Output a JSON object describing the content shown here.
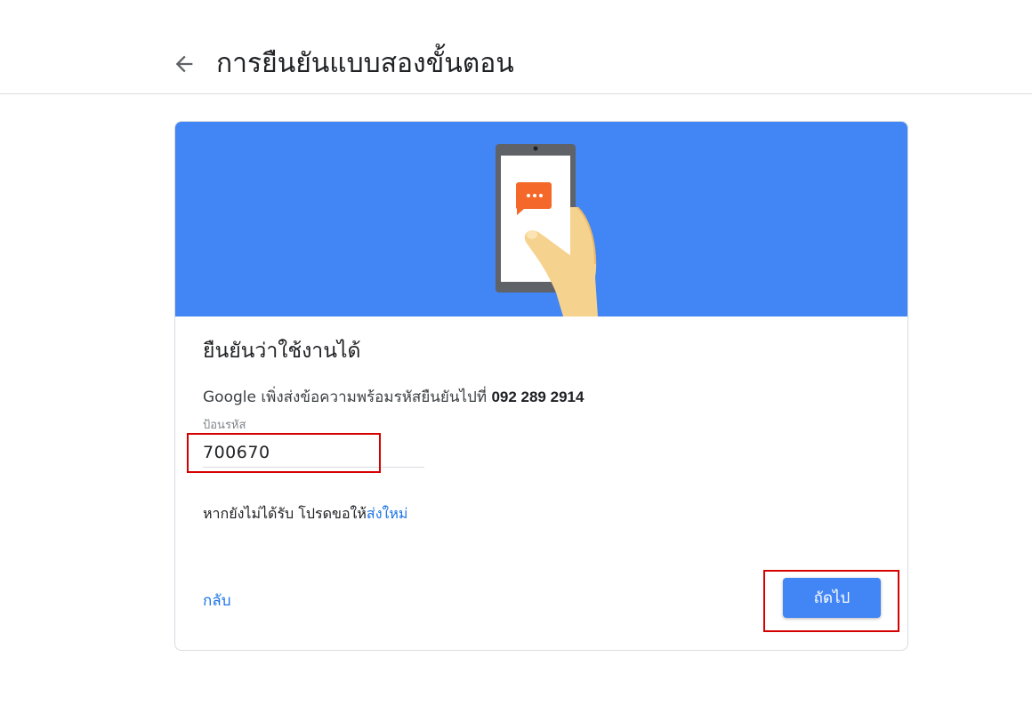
{
  "header": {
    "back_icon": "arrow-left-icon",
    "title": "การยืนยันแบบสองขั้นตอน"
  },
  "banner": {
    "background_color": "#4285f4",
    "illustration": "phone-with-message-icon",
    "message_bubble_color": "#f4692a"
  },
  "verify": {
    "title": "ยืนยันว่าใช้งานได้",
    "description": "Google เพิ่งส่งข้อความพร้อมรหัสยืนยันไปที่ ",
    "phone_number": "092 289 2914",
    "field_label": "ป้อนรหัส",
    "code_value": "700670",
    "resend_prefix": "หากยังไม่ได้รับ โปรดขอให้",
    "resend_link": "ส่งใหม่"
  },
  "actions": {
    "back_label": "กลับ",
    "next_label": "ถัดไป"
  },
  "colors": {
    "accent": "#1a73e8",
    "button": "#4285f4",
    "highlight": "#d50000"
  }
}
